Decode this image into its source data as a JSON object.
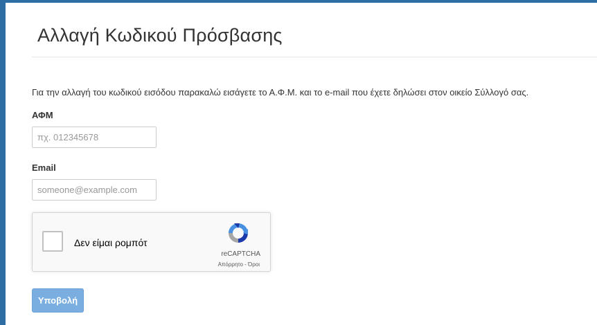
{
  "page": {
    "title": "Αλλαγή Κωδικού Πρόσβασης",
    "instructions": "Για την αλλαγή του κωδικού εισόδου παρακαλώ εισάγετε το Α.Φ.Μ. και το e-mail που έχετε δηλώσει στον οικείο Σύλλογό σας."
  },
  "form": {
    "afm_label": "ΑΦΜ",
    "afm_placeholder": "πχ. 012345678",
    "afm_value": "",
    "email_label": "Email",
    "email_placeholder": "someone@example.com",
    "email_value": "",
    "submit_label": "Υποβολή"
  },
  "recaptcha": {
    "label": "Δεν είμαι ρομπότ",
    "brand": "reCAPTCHA",
    "terms": "Απόρρητο - Όροι",
    "icon": "recaptcha-logo-icon",
    "checked": false
  },
  "colors": {
    "frame_border": "#2e6da4",
    "submit_button": "#7aaee0"
  }
}
